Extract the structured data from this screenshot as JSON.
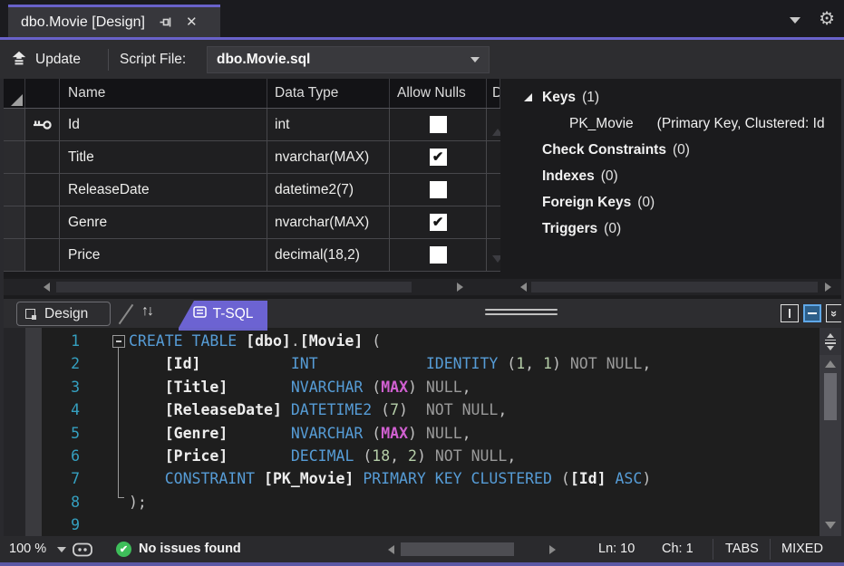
{
  "colors": {
    "accent": "#6962CA",
    "tsql_tab": "#6C63D2",
    "keyword_blue": "#569CD6",
    "number_green": "#B5CEA8",
    "max_magenta": "#D160D1",
    "line_number_teal": "#35A0C0",
    "status_green": "#3EBE5A"
  },
  "doc_tab": {
    "title": "dbo.Movie [Design]"
  },
  "toolbar": {
    "update": "Update",
    "script_file_label": "Script File:",
    "script_file_value": "dbo.Movie.sql"
  },
  "grid": {
    "columns": [
      "Name",
      "Data Type",
      "Allow Nulls",
      "D"
    ],
    "rows": [
      {
        "name": "Id",
        "data_type": "int",
        "allow_nulls": false,
        "is_key": true
      },
      {
        "name": "Title",
        "data_type": "nvarchar(MAX)",
        "allow_nulls": true,
        "is_key": false
      },
      {
        "name": "ReleaseDate",
        "data_type": "datetime2(7)",
        "allow_nulls": false,
        "is_key": false
      },
      {
        "name": "Genre",
        "data_type": "nvarchar(MAX)",
        "allow_nulls": true,
        "is_key": false
      },
      {
        "name": "Price",
        "data_type": "decimal(18,2)",
        "allow_nulls": false,
        "is_key": false
      }
    ]
  },
  "context_pane": {
    "nodes": [
      {
        "label": "Keys",
        "count": "(1)",
        "expanded": true,
        "child": {
          "name": "PK_Movie",
          "detail": "(Primary Key, Clustered: Id"
        }
      },
      {
        "label": "Check Constraints",
        "count": "(0)"
      },
      {
        "label": "Indexes",
        "count": "(0)"
      },
      {
        "label": "Foreign Keys",
        "count": "(0)"
      },
      {
        "label": "Triggers",
        "count": "(0)"
      }
    ]
  },
  "pane_tabs": {
    "design": "Design",
    "tsql": "T-SQL"
  },
  "editor": {
    "lines": [
      {
        "n": "1",
        "segs": [
          [
            "kw",
            "CREATE TABLE"
          ],
          [
            "pl",
            " "
          ],
          [
            "id",
            "[dbo]"
          ],
          [
            "pl",
            "."
          ],
          [
            "id",
            "[Movie]"
          ],
          [
            "pl",
            " ("
          ]
        ]
      },
      {
        "n": "2",
        "segs": [
          [
            "pl",
            "    "
          ],
          [
            "id",
            "[Id]"
          ],
          [
            "pl",
            "          "
          ],
          [
            "kw",
            "INT"
          ],
          [
            "pl",
            "            "
          ],
          [
            "kw",
            "IDENTITY"
          ],
          [
            "pl",
            " ("
          ],
          [
            "num",
            "1"
          ],
          [
            "pl",
            ", "
          ],
          [
            "num",
            "1"
          ],
          [
            "pl",
            ") "
          ],
          [
            "gr",
            "NOT NULL"
          ],
          [
            "pl",
            ","
          ]
        ]
      },
      {
        "n": "3",
        "segs": [
          [
            "pl",
            "    "
          ],
          [
            "id",
            "[Title]"
          ],
          [
            "pl",
            "       "
          ],
          [
            "kw",
            "NVARCHAR"
          ],
          [
            "pl",
            " ("
          ],
          [
            "mag",
            "MAX"
          ],
          [
            "pl",
            ") "
          ],
          [
            "gr",
            "NULL"
          ],
          [
            "pl",
            ","
          ]
        ]
      },
      {
        "n": "4",
        "segs": [
          [
            "pl",
            "    "
          ],
          [
            "id",
            "[ReleaseDate]"
          ],
          [
            "pl",
            " "
          ],
          [
            "kw",
            "DATETIME2"
          ],
          [
            "pl",
            " ("
          ],
          [
            "num",
            "7"
          ],
          [
            "pl",
            ")  "
          ],
          [
            "gr",
            "NOT NULL"
          ],
          [
            "pl",
            ","
          ]
        ]
      },
      {
        "n": "5",
        "segs": [
          [
            "pl",
            "    "
          ],
          [
            "id",
            "[Genre]"
          ],
          [
            "pl",
            "       "
          ],
          [
            "kw",
            "NVARCHAR"
          ],
          [
            "pl",
            " ("
          ],
          [
            "mag",
            "MAX"
          ],
          [
            "pl",
            ") "
          ],
          [
            "gr",
            "NULL"
          ],
          [
            "pl",
            ","
          ]
        ]
      },
      {
        "n": "6",
        "segs": [
          [
            "pl",
            "    "
          ],
          [
            "id",
            "[Price]"
          ],
          [
            "pl",
            "       "
          ],
          [
            "kw",
            "DECIMAL"
          ],
          [
            "pl",
            " ("
          ],
          [
            "num",
            "18"
          ],
          [
            "pl",
            ", "
          ],
          [
            "num",
            "2"
          ],
          [
            "pl",
            ") "
          ],
          [
            "gr",
            "NOT NULL"
          ],
          [
            "pl",
            ","
          ]
        ]
      },
      {
        "n": "7",
        "segs": [
          [
            "pl",
            "    "
          ],
          [
            "kw",
            "CONSTRAINT"
          ],
          [
            "pl",
            " "
          ],
          [
            "id",
            "[PK_Movie]"
          ],
          [
            "pl",
            " "
          ],
          [
            "kw",
            "PRIMARY KEY CLUSTERED"
          ],
          [
            "pl",
            " ("
          ],
          [
            "id",
            "[Id]"
          ],
          [
            "pl",
            " "
          ],
          [
            "kw",
            "ASC"
          ],
          [
            "pl",
            ")"
          ]
        ]
      },
      {
        "n": "8",
        "segs": [
          [
            "pl",
            ");"
          ]
        ]
      },
      {
        "n": "9",
        "segs": []
      }
    ]
  },
  "status": {
    "zoom": "100 %",
    "message": "No issues found",
    "ln": "Ln: 10",
    "ch": "Ch: 1",
    "indent": "TABS",
    "encoding": "MIXED"
  }
}
